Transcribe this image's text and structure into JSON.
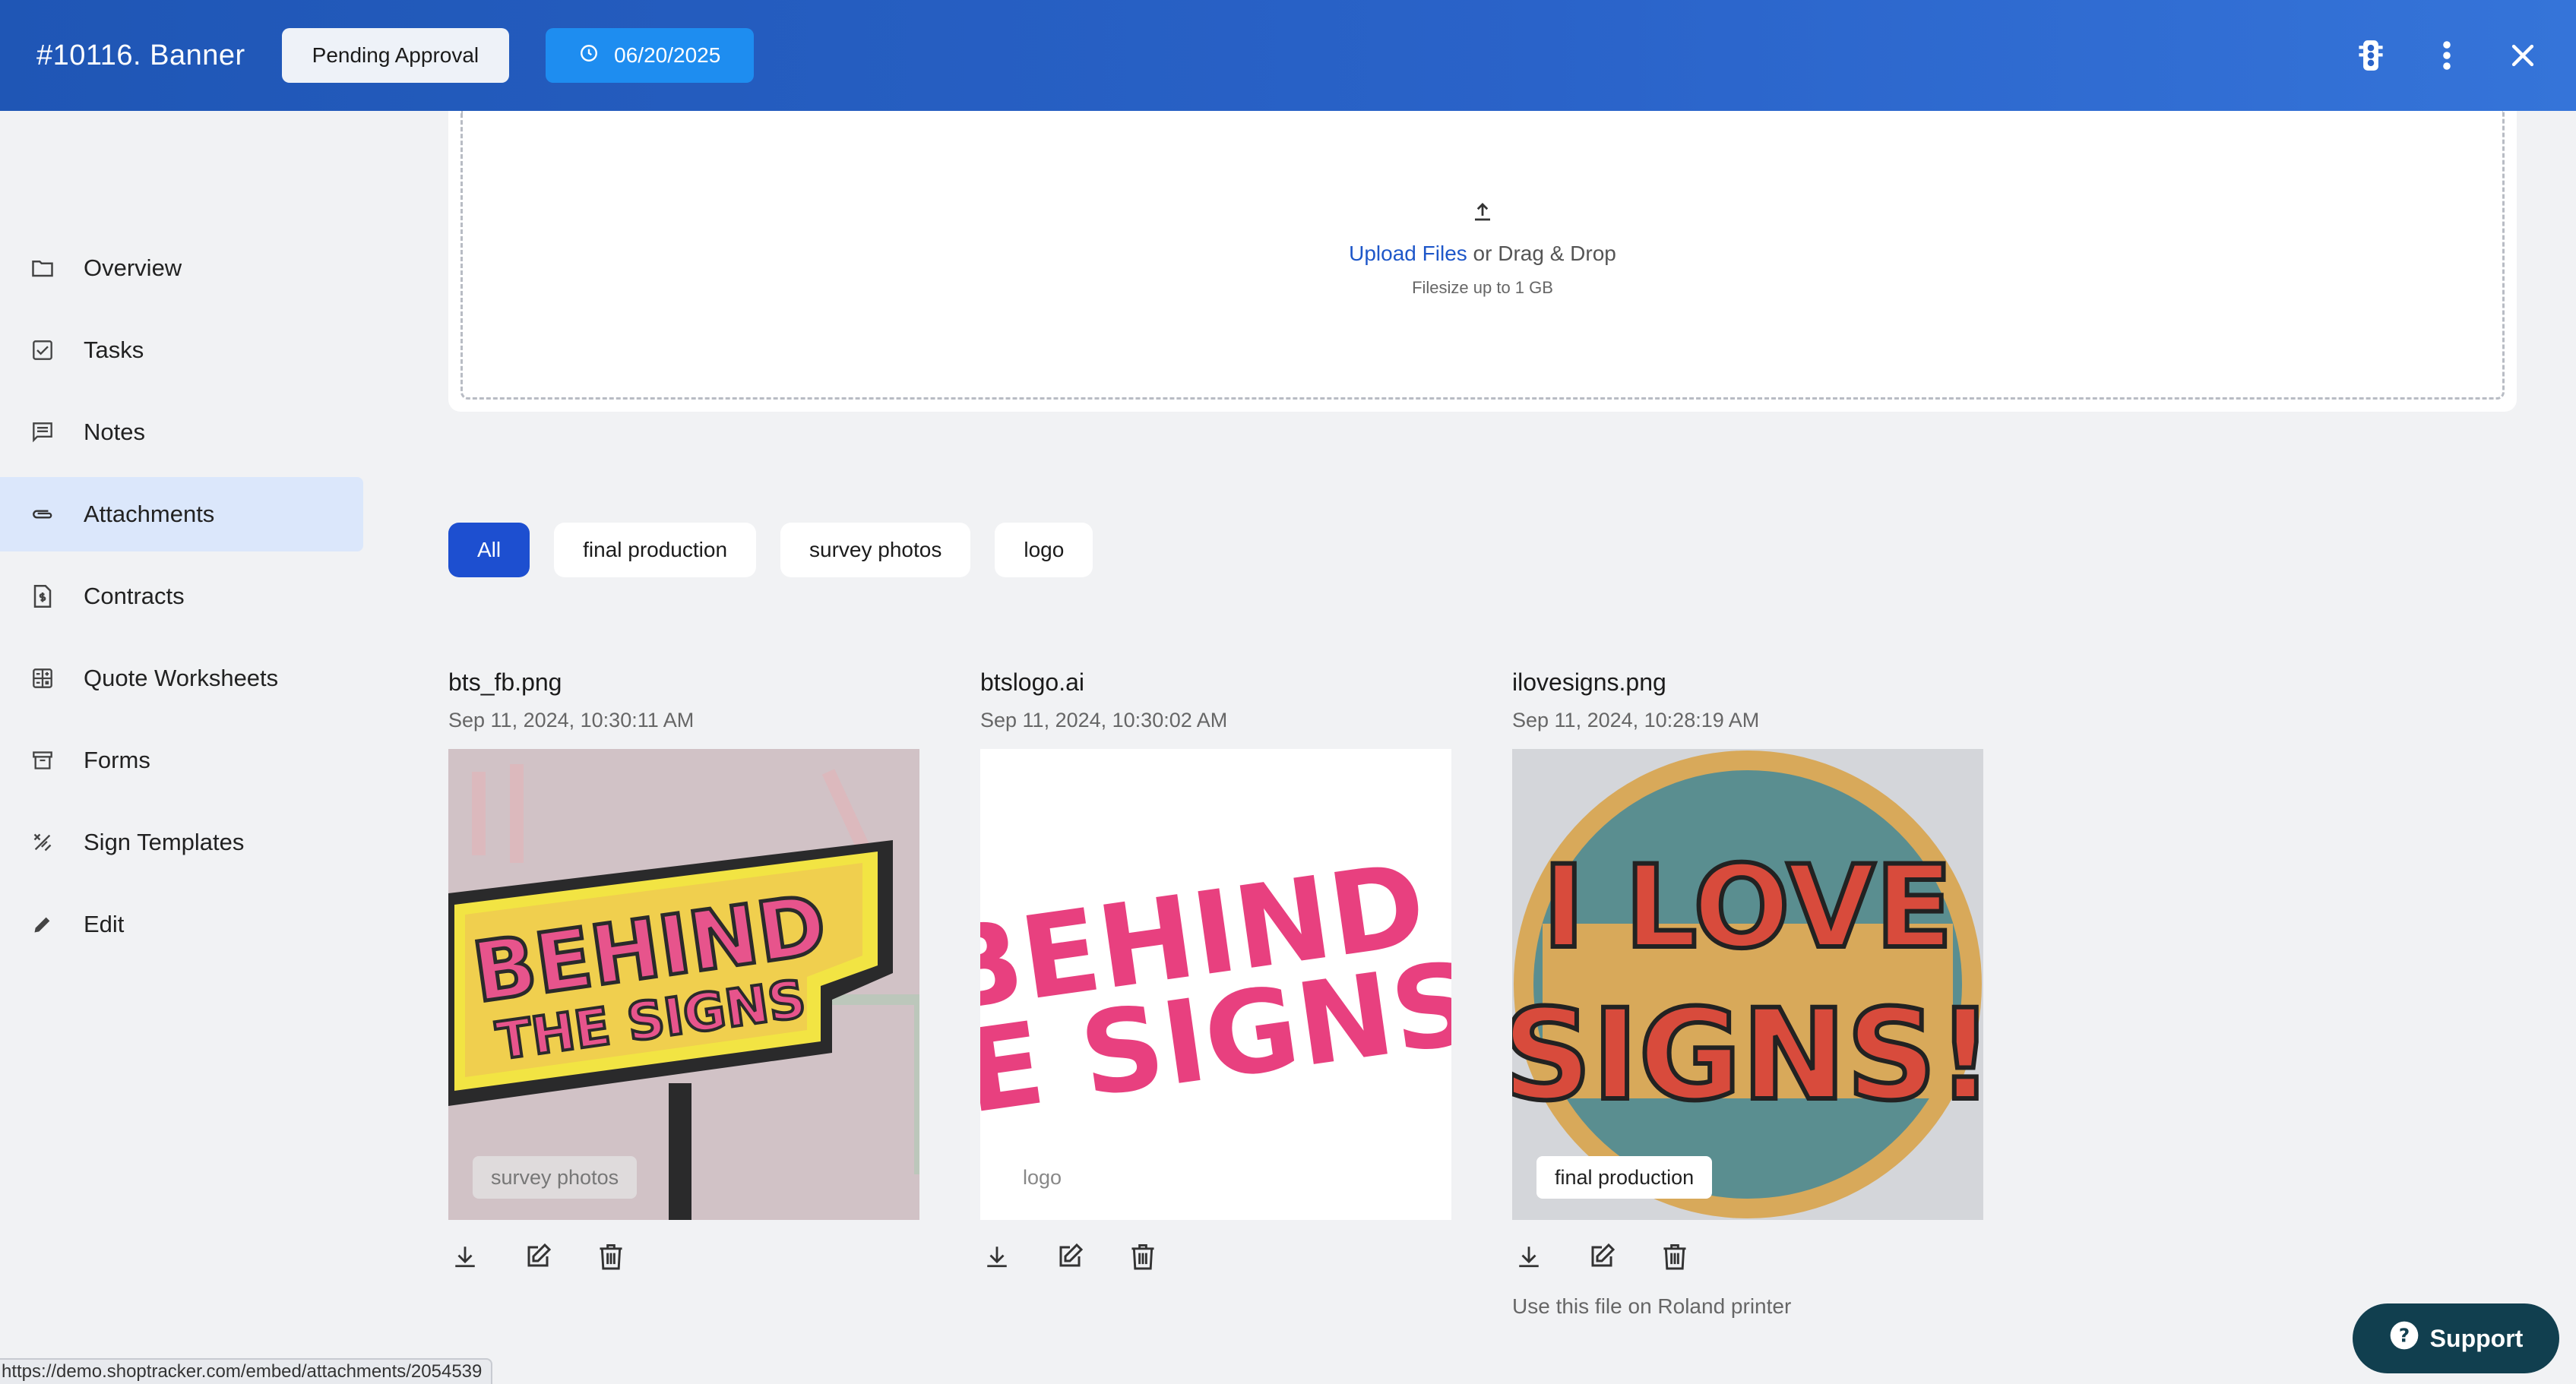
{
  "header": {
    "title": "#10116. Banner",
    "status_label": "Pending Approval",
    "due_date": "06/20/2025",
    "icons": [
      "traffic-light-icon",
      "more-vertical-icon",
      "close-icon"
    ]
  },
  "sidebar": {
    "items": [
      {
        "label": "Overview",
        "icon": "folder-icon",
        "active": false
      },
      {
        "label": "Tasks",
        "icon": "checkbox-icon",
        "active": false
      },
      {
        "label": "Notes",
        "icon": "comment-icon",
        "active": false
      },
      {
        "label": "Attachments",
        "icon": "paperclip-icon",
        "active": true
      },
      {
        "label": "Contracts",
        "icon": "document-dollar-icon",
        "active": false
      },
      {
        "label": "Quote Worksheets",
        "icon": "calculator-icon",
        "active": false
      },
      {
        "label": "Forms",
        "icon": "archive-box-icon",
        "active": false
      },
      {
        "label": "Sign Templates",
        "icon": "design-tools-icon",
        "active": false
      },
      {
        "label": "Edit",
        "icon": "pencil-icon",
        "active": false
      }
    ]
  },
  "upload": {
    "link_text": "Upload Files",
    "suffix_text": " or Drag & Drop",
    "filesize_text": "Filesize up to 1 GB"
  },
  "filters": {
    "items": [
      "All",
      "final production",
      "survey photos",
      "logo"
    ],
    "active": "All"
  },
  "attachments": [
    {
      "name": "bts_fb.png",
      "date": "Sep 11, 2024, 10:30:11 AM",
      "tag": "survey photos",
      "image_text": [
        "BEHIND",
        "THE SIGNS"
      ],
      "note": ""
    },
    {
      "name": "btslogo.ai",
      "date": "Sep 11, 2024, 10:30:02 AM",
      "tag": "logo",
      "image_text": [
        "BEHIND",
        "HE SIGNS"
      ],
      "note": ""
    },
    {
      "name": "ilovesigns.png",
      "date": "Sep 11, 2024, 10:28:19 AM",
      "tag": "final production",
      "image_text": [
        "I LOVE",
        "SIGNS!"
      ],
      "note": "Use this file on Roland printer"
    }
  ],
  "support": {
    "label": "Support"
  },
  "status_url": "https://demo.shoptracker.com/embed/attachments/2054539",
  "colors": {
    "header": "#2a63c9",
    "primary": "#1d4fd0",
    "date_button": "#1e8df0",
    "active_nav": "#dbe7fb",
    "support": "#113f4f"
  }
}
